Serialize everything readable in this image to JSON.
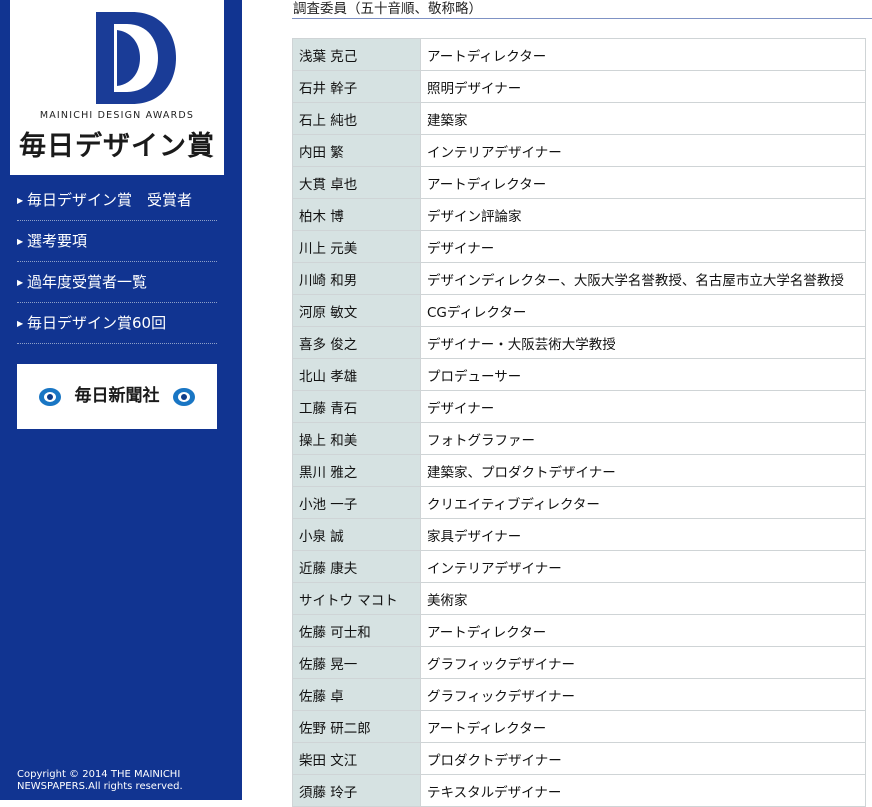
{
  "logo": {
    "english": "MAINICHI DESIGN AWARDS",
    "japanese": "毎日デザイン賞"
  },
  "nav": [
    {
      "label": "毎日デザイン賞　受賞者"
    },
    {
      "label": "選考要項"
    },
    {
      "label": "過年度受賞者一覧"
    },
    {
      "label": "毎日デザイン賞60回"
    }
  ],
  "banner": {
    "label": "毎日新聞社"
  },
  "copyright": "Copyright © 2014 THE MAINICHI NEWSPAPERS.All rights reserved.",
  "section_title": "調査委員（五十音順、敬称略）",
  "members": [
    {
      "name": "浅葉 克己",
      "role": "アートディレクター"
    },
    {
      "name": "石井 幹子",
      "role": "照明デザイナー"
    },
    {
      "name": "石上 純也",
      "role": "建築家"
    },
    {
      "name": "内田 繁",
      "role": "インテリアデザイナー"
    },
    {
      "name": "大貫 卓也",
      "role": "アートディレクター"
    },
    {
      "name": "柏木 博",
      "role": "デザイン評論家"
    },
    {
      "name": "川上 元美",
      "role": "デザイナー"
    },
    {
      "name": "川崎 和男",
      "role": "デザインディレクター、大阪大学名誉教授、名古屋市立大学名誉教授"
    },
    {
      "name": "河原 敏文",
      "role": "CGディレクター"
    },
    {
      "name": "喜多 俊之",
      "role": "デザイナー・大阪芸術大学教授"
    },
    {
      "name": "北山 孝雄",
      "role": "プロデューサー"
    },
    {
      "name": "工藤 青石",
      "role": "デザイナー"
    },
    {
      "name": "操上 和美",
      "role": "フォトグラファー"
    },
    {
      "name": "黒川 雅之",
      "role": "建築家、プロダクトデザイナー"
    },
    {
      "name": "小池 一子",
      "role": "クリエイティブディレクター"
    },
    {
      "name": "小泉 誠",
      "role": "家具デザイナー"
    },
    {
      "name": "近藤 康夫",
      "role": "インテリアデザイナー"
    },
    {
      "name": "サイトウ マコト",
      "role": "美術家"
    },
    {
      "name": "佐藤 可士和",
      "role": "アートディレクター"
    },
    {
      "name": "佐藤 晃一",
      "role": "グラフィックデザイナー"
    },
    {
      "name": "佐藤 卓",
      "role": "グラフィックデザイナー"
    },
    {
      "name": "佐野 研二郎",
      "role": "アートディレクター"
    },
    {
      "name": "柴田 文江",
      "role": "プロダクトデザイナー"
    },
    {
      "name": "須藤 玲子",
      "role": "テキスタルデザイナー"
    }
  ]
}
